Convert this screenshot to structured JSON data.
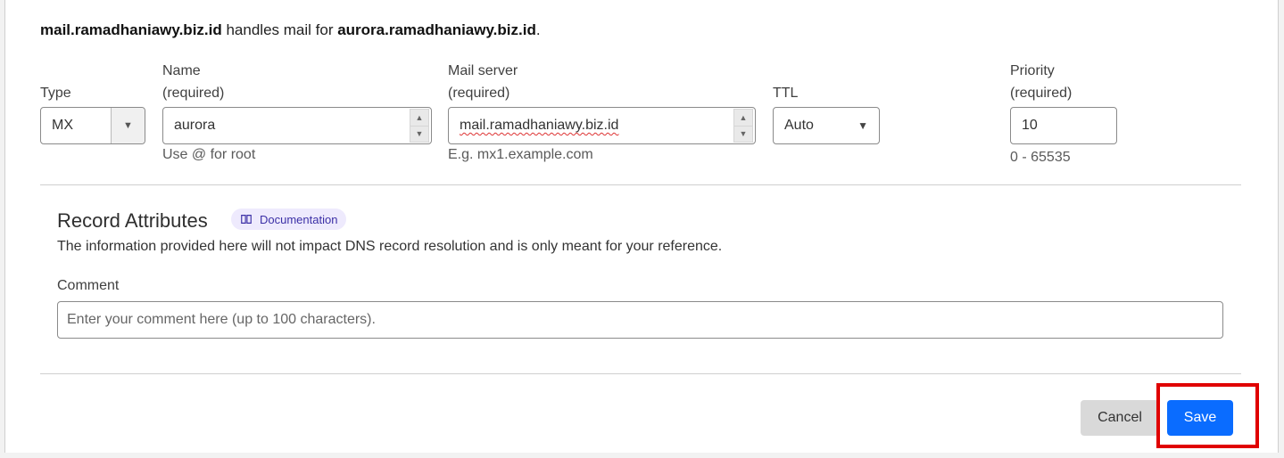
{
  "summary": {
    "server": "mail.ramadhaniawy.biz.id",
    "middle": " handles mail for ",
    "domain": "aurora.ramadhaniawy.biz.id",
    "end": "."
  },
  "fields": {
    "type": {
      "label": "Type",
      "value": "MX"
    },
    "name": {
      "label": "Name",
      "required": "(required)",
      "value": "aurora",
      "hint": "Use @ for root"
    },
    "mail_server": {
      "label": "Mail server",
      "required": "(required)",
      "value": "mail.ramadhaniawy.biz.id",
      "hint": "E.g. mx1.example.com"
    },
    "ttl": {
      "label": "TTL",
      "value": "Auto"
    },
    "priority": {
      "label": "Priority",
      "required": "(required)",
      "value": "10",
      "hint": "0 - 65535"
    }
  },
  "attributes": {
    "title": "Record Attributes",
    "doc_label": "Documentation",
    "description": "The information provided here will not impact DNS record resolution and is only meant for your reference.",
    "comment_label": "Comment",
    "comment_placeholder": "Enter your comment here (up to 100 characters)."
  },
  "actions": {
    "cancel": "Cancel",
    "save": "Save"
  },
  "colors": {
    "primary": "#0a6cff",
    "highlight": "#e00000",
    "badge_bg": "#eeeafd"
  },
  "icons": {
    "type_caret": "chevron-down-icon",
    "ttl_caret": "chevron-down-icon",
    "spinner": "spin-up-down-icon",
    "doc": "book-icon"
  }
}
